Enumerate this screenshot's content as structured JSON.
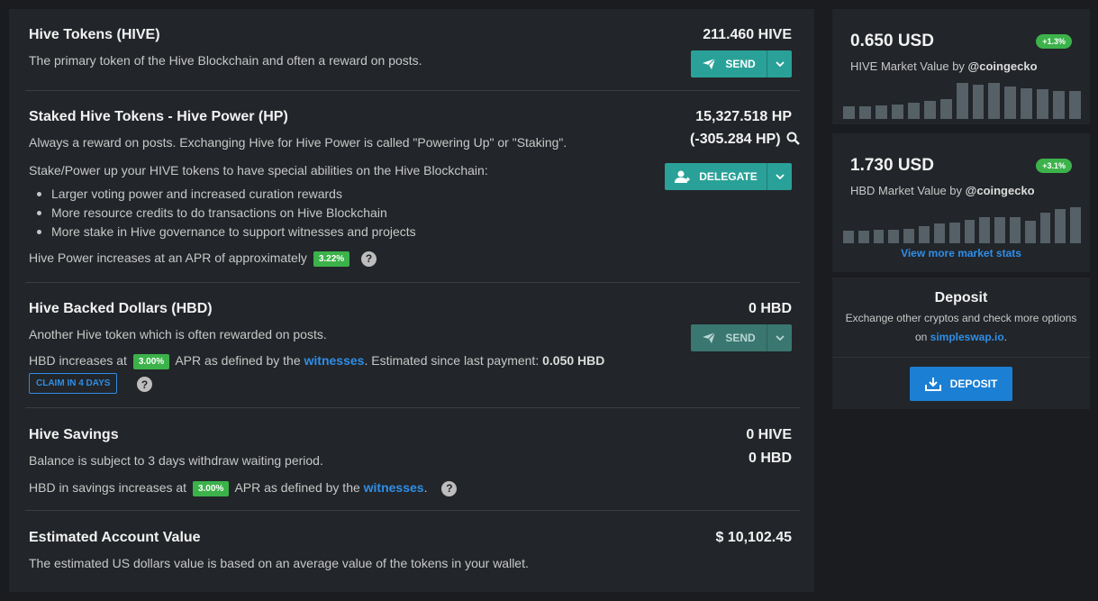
{
  "wallet": {
    "hive": {
      "title": "Hive Tokens (HIVE)",
      "description": "The primary token of the Hive Blockchain and often a reward on posts.",
      "amount": "211.460 HIVE",
      "send_label": "SEND"
    },
    "hp": {
      "title": "Staked Hive Tokens - Hive Power (HP)",
      "description": "Always a reward on posts. Exchanging Hive for Hive Power is called \"Powering Up\" or \"Staking\".",
      "intro": "Stake/Power up your HIVE tokens to have special abilities on the Hive Blockchain:",
      "bullets": [
        "Larger voting power and increased curation rewards",
        "More resource credits to do transactions on Hive Blockchain",
        "More stake in Hive governance to support witnesses and projects"
      ],
      "apr_text": "Hive Power increases at an APR of approximately",
      "apr_badge": "3.22%",
      "amount": "15,327.518 HP",
      "delegated": "(-305.284 HP)",
      "delegate_label": "DELEGATE"
    },
    "hbd": {
      "title": "Hive Backed Dollars (HBD)",
      "description": "Another Hive token which is often rewarded on posts.",
      "apr_prefix": "HBD increases at",
      "apr_badge": "3.00%",
      "apr_mid": "APR as defined by the",
      "witnesses_link": "witnesses",
      "apr_suffix": ". Estimated since last payment:",
      "estimated": "0.050 HBD",
      "claim_label": "CLAIM IN 4 DAYS",
      "amount": "0 HBD",
      "send_label": "SEND"
    },
    "savings": {
      "title": "Hive Savings",
      "description": "Balance is subject to 3 days withdraw waiting period.",
      "apr_prefix": "HBD in savings increases at",
      "apr_badge": "3.00%",
      "apr_mid": "APR as defined by the",
      "witnesses_link": "witnesses",
      "apr_suffix": ".",
      "amount_hive": "0 HIVE",
      "amount_hbd": "0 HBD"
    },
    "estimated": {
      "title": "Estimated Account Value",
      "description": "The estimated US dollars value is based on an average value of the tokens in your wallet.",
      "amount": "$ 10,102.45"
    }
  },
  "market": {
    "hive": {
      "price": "0.650 USD",
      "change": "+1.3%",
      "label_prefix": "HIVE Market Value by",
      "source": "@coingecko",
      "bars": [
        0.33,
        0.33,
        0.36,
        0.39,
        0.42,
        0.47,
        0.52,
        0.95,
        0.9,
        0.95,
        0.85,
        0.82,
        0.78,
        0.75,
        0.73
      ]
    },
    "hbd": {
      "price": "1.730 USD",
      "change": "+3.1%",
      "label_prefix": "HBD Market Value by",
      "source": "@coingecko",
      "bars": [
        0.33,
        0.33,
        0.36,
        0.36,
        0.38,
        0.45,
        0.52,
        0.55,
        0.62,
        0.7,
        0.7,
        0.68,
        0.6,
        0.82,
        0.9,
        0.95
      ]
    },
    "more_link": "View more market stats"
  },
  "deposit": {
    "title": "Deposit",
    "text_line1": "Exchange other cryptos and check more options",
    "text_on": "on",
    "link": "simpleswap.io",
    "text_end": ".",
    "button_label": "DEPOSIT"
  },
  "colors": {
    "accent_teal": "#2aa198",
    "link_blue": "#2f8ee8",
    "badge_green": "#3cb24a",
    "deposit_blue": "#1b7fd3"
  }
}
